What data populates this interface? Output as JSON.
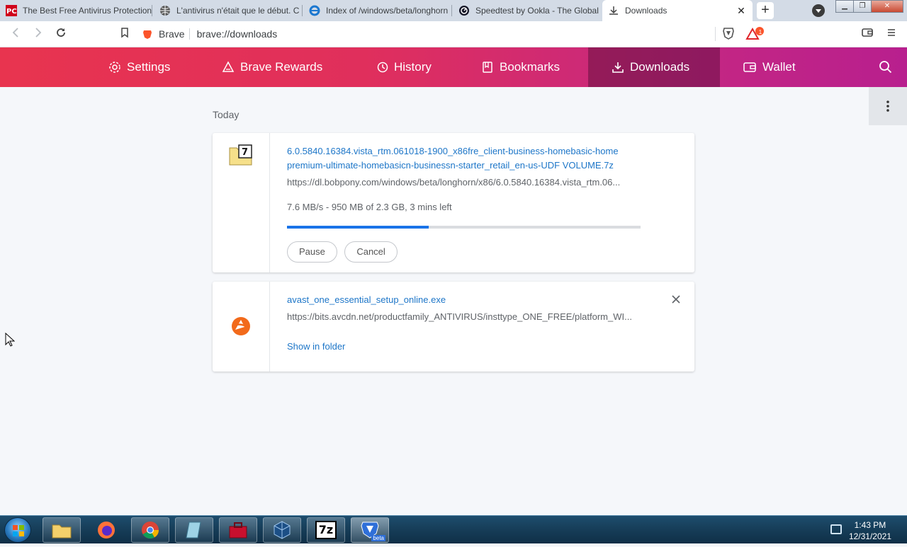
{
  "browser": {
    "tabs": [
      {
        "title": "The Best Free Antivirus Protection",
        "favicon": "pc-logo-icon"
      },
      {
        "title": "L'antivirus n'était que le début. C",
        "favicon": "globe-icon"
      },
      {
        "title": "Index of /windows/beta/longhorn",
        "favicon": "ie-icon"
      },
      {
        "title": "Speedtest by Ookla - The Global",
        "favicon": "speedtest-icon"
      },
      {
        "title": "Downloads",
        "favicon": "download-icon",
        "active": true
      }
    ],
    "address_chip": "Brave",
    "address_url": "brave://downloads",
    "rewards_badge": "1"
  },
  "nav": {
    "items": [
      {
        "label": "Settings",
        "icon": "gear-icon"
      },
      {
        "label": "Brave Rewards",
        "icon": "triangle-icon"
      },
      {
        "label": "History",
        "icon": "history-icon"
      },
      {
        "label": "Bookmarks",
        "icon": "bookmark-icon"
      },
      {
        "label": "Downloads",
        "icon": "download-icon",
        "active": true
      },
      {
        "label": "Wallet",
        "icon": "wallet-icon"
      }
    ],
    "colors": {
      "start": "#e8344f",
      "end": "#b81f8e"
    }
  },
  "downloads": {
    "section_label": "Today",
    "items": [
      {
        "filename": "6.0.5840.16384.vista_rtm.061018-1900_x86fre_client-business-homebasic-homepremium-ultimate-homebasicn-businessn-starter_retail_en-us-UDF VOLUME.7z",
        "filename_line1": "6.0.5840.16384.vista_rtm.061018-1900_x86fre_client-business-homebasic-home",
        "filename_line2": "premium-ultimate-homebasicn-businessn-starter_retail_en-us-UDF VOLUME.7z",
        "url": "https://dl.bobpony.com/windows/beta/longhorn/x86/6.0.5840.16384.vista_rtm.06...",
        "status": "7.6 MB/s - 950 MB of 2.3 GB, 3 mins left",
        "progress": 0.4,
        "pause_label": "Pause",
        "cancel_label": "Cancel",
        "icon": "7z-archive-icon"
      },
      {
        "filename": "avast_one_essential_setup_online.exe",
        "url": "https://bits.avcdn.net/productfamily_ANTIVIRUS/insttype_ONE_FREE/platform_WI...",
        "link_label": "Show in folder",
        "icon": "avast-icon"
      }
    ]
  },
  "taskbar": {
    "time": "1:43 PM",
    "date": "12/31/2021",
    "items": [
      "explorer-icon",
      "firefox-icon",
      "chrome-icon",
      "notepad-icon",
      "toolbox-icon",
      "virtualbox-icon",
      "7zip-icon",
      "brave-beta-icon"
    ],
    "tbitem_7zip_label": "7z",
    "brave_beta_label": "beta"
  }
}
